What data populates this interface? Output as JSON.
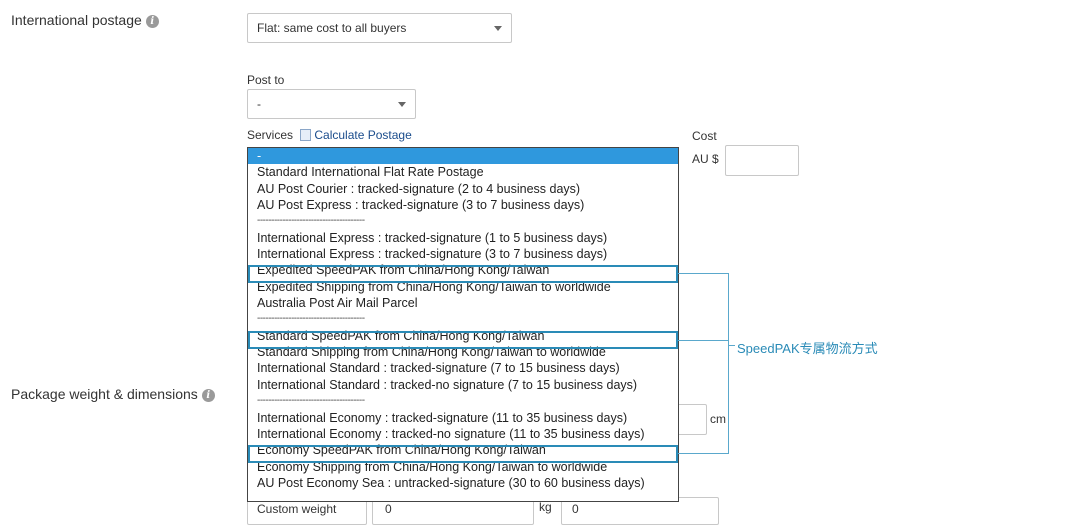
{
  "intl_postage": {
    "label": "International postage",
    "select_value": "Flat: same cost to all buyers"
  },
  "post_to": {
    "label": "Post to",
    "select_value": "-"
  },
  "services": {
    "label": "Services",
    "calc_link": "Calculate Postage",
    "options": [
      "-",
      "Standard International Flat Rate Postage",
      "AU Post Courier : tracked-signature (2 to 4 business days)",
      "AU Post Express : tracked-signature (3 to 7 business days)",
      "--------------------------------------",
      "International Express : tracked-signature (1 to 5 business days)",
      "International Express : tracked-signature (3 to 7 business days)",
      "Expedited SpeedPAK from China/Hong Kong/Taiwan",
      "Expedited Shipping from China/Hong Kong/Taiwan to worldwide",
      "Australia Post Air Mail Parcel",
      "--------------------------------------",
      "Standard SpeedPAK from China/Hong Kong/Taiwan",
      "Standard Shipping from China/Hong Kong/Taiwan to worldwide",
      "International Standard : tracked-signature (7 to 15 business days)",
      "International Standard : tracked-no signature (7 to 15 business days)",
      "--------------------------------------",
      "International Economy : tracked-signature (11 to 35 business days)",
      "International Economy : tracked-no signature (11 to 35 business days)",
      "Economy SpeedPAK from China/Hong Kong/Taiwan",
      "Economy Shipping from China/Hong Kong/Taiwan to worldwide",
      "AU Post Economy Sea : untracked-signature (30 to 60 business days)"
    ],
    "selected_index": 0
  },
  "cost": {
    "label": "Cost",
    "currency": "AU $",
    "value": ""
  },
  "package": {
    "label": "Package weight & dimensions",
    "dim_unit": "cm",
    "weight_select": "Custom weight",
    "weight_value": "0",
    "weight_unit": "kg",
    "weight_value2": "0"
  },
  "annotation": {
    "text": "SpeedPAK专属物流方式",
    "color": "#2a8bb7"
  },
  "colors": {
    "highlight": "#2a8bb7",
    "selected_option": "#2f98dd"
  }
}
